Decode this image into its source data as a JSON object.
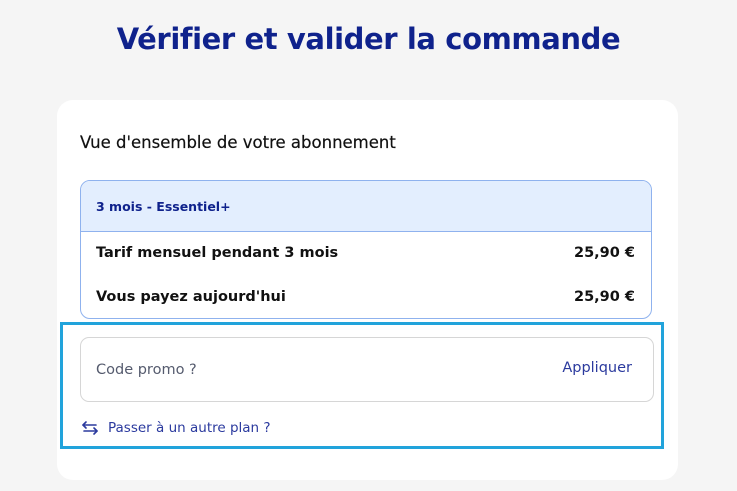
{
  "page": {
    "title": "Vérifier et valider la commande"
  },
  "overview": {
    "heading": "Vue d'ensemble de votre abonnement",
    "plan_name": "3 mois - Essentiel+",
    "rows": [
      {
        "label": "Tarif mensuel pendant 3 mois",
        "value": "25,90 €"
      },
      {
        "label": "Vous payez aujourd'hui",
        "value": "25,90 €"
      }
    ]
  },
  "promo": {
    "placeholder": "Code promo ?",
    "apply_label": "Appliquer"
  },
  "switch_plan": {
    "label": "Passer à un autre plan ?",
    "icon": "swap-arrows-icon"
  },
  "colors": {
    "title": "#0f228c",
    "link": "#2b3a9e",
    "plan_header_bg": "#e3eefe",
    "plan_border": "#8fb2ee",
    "highlight_border": "#21a3db",
    "page_bg": "#f5f5f5"
  }
}
